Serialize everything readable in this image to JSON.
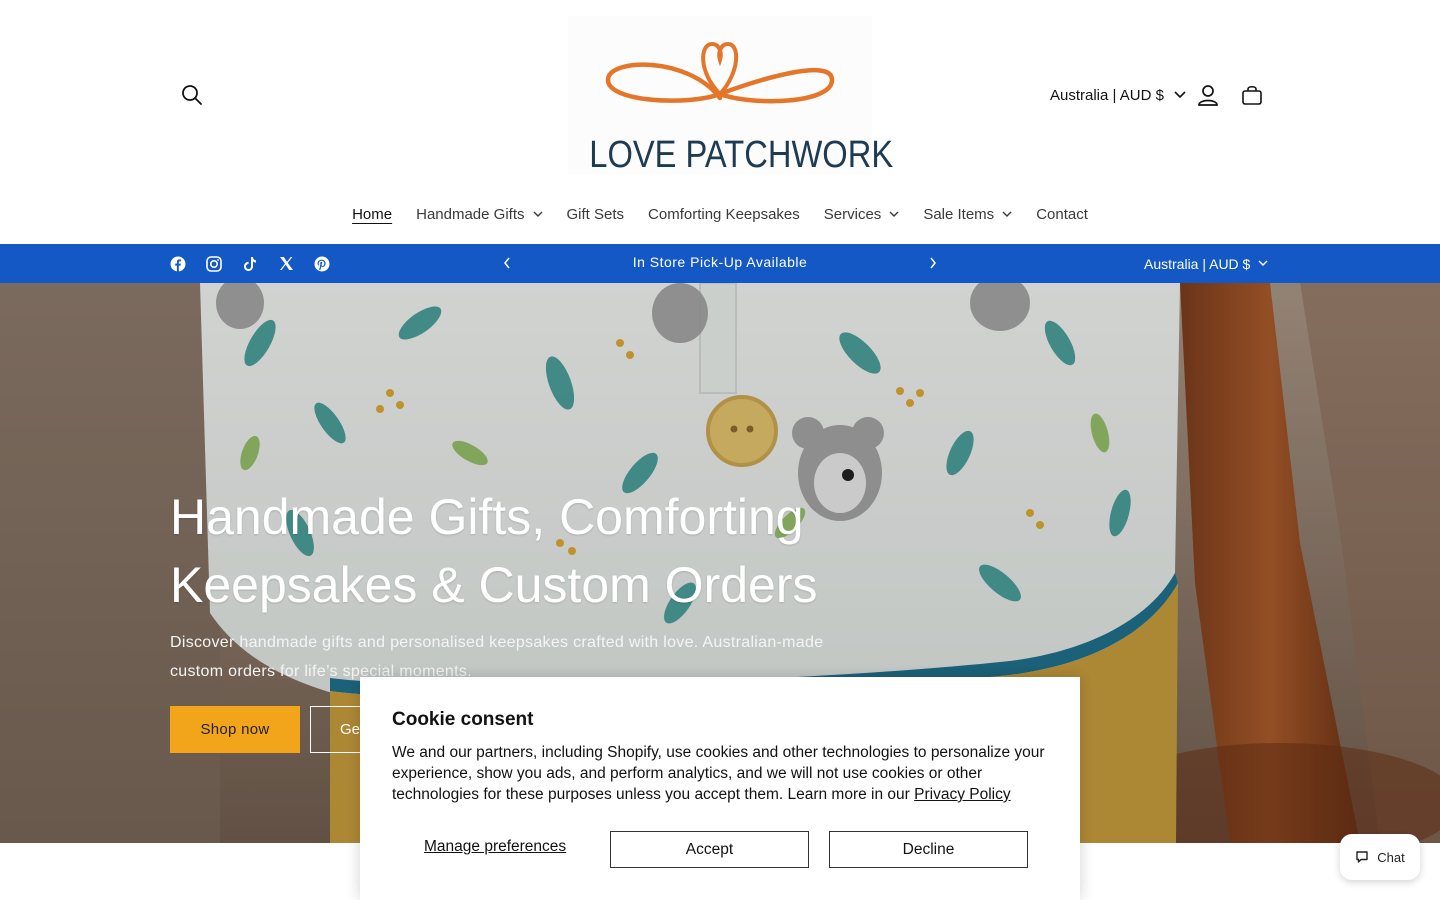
{
  "header": {
    "logo_text": "LOVE PATCHWORK",
    "country_selector": "Australia | AUD $",
    "icons": [
      "search-icon",
      "account-icon",
      "cart-icon",
      "chevron-down-icon"
    ]
  },
  "nav": {
    "items": [
      {
        "label": "Home",
        "active": true,
        "dropdown": false
      },
      {
        "label": "Handmade Gifts",
        "active": false,
        "dropdown": true
      },
      {
        "label": "Gift Sets",
        "active": false,
        "dropdown": false
      },
      {
        "label": "Comforting Keepsakes",
        "active": false,
        "dropdown": false
      },
      {
        "label": "Services",
        "active": false,
        "dropdown": true
      },
      {
        "label": "Sale Items",
        "active": false,
        "dropdown": true
      },
      {
        "label": "Contact",
        "active": false,
        "dropdown": false
      }
    ]
  },
  "announcement": {
    "social_icons": [
      "facebook-icon",
      "instagram-icon",
      "tiktok-icon",
      "x-icon",
      "pinterest-icon"
    ],
    "message": "In Store Pick-Up Available",
    "country_selector": "Australia | AUD $",
    "background": "#1358c4"
  },
  "hero": {
    "title": "Handmade Gifts, Comforting Keepsakes & Custom Orders",
    "subtitle": "Discover handmade gifts and personalised keepsakes crafted with love. Australian-made custom orders for life’s special moments.",
    "primary_button": "Shop now",
    "secondary_button": "Get",
    "primary_color": "#f2a51a"
  },
  "cookie": {
    "title": "Cookie consent",
    "body": "We and our partners, including Shopify, use cookies and other technologies to personalize your experience, show you ads, and perform analytics, and we will not use cookies or other technologies for these purposes unless you accept them. Learn more in our",
    "link": "Privacy Policy",
    "manage": "Manage preferences",
    "accept": "Accept",
    "decline": "Decline"
  },
  "chat": {
    "label": "Chat"
  }
}
